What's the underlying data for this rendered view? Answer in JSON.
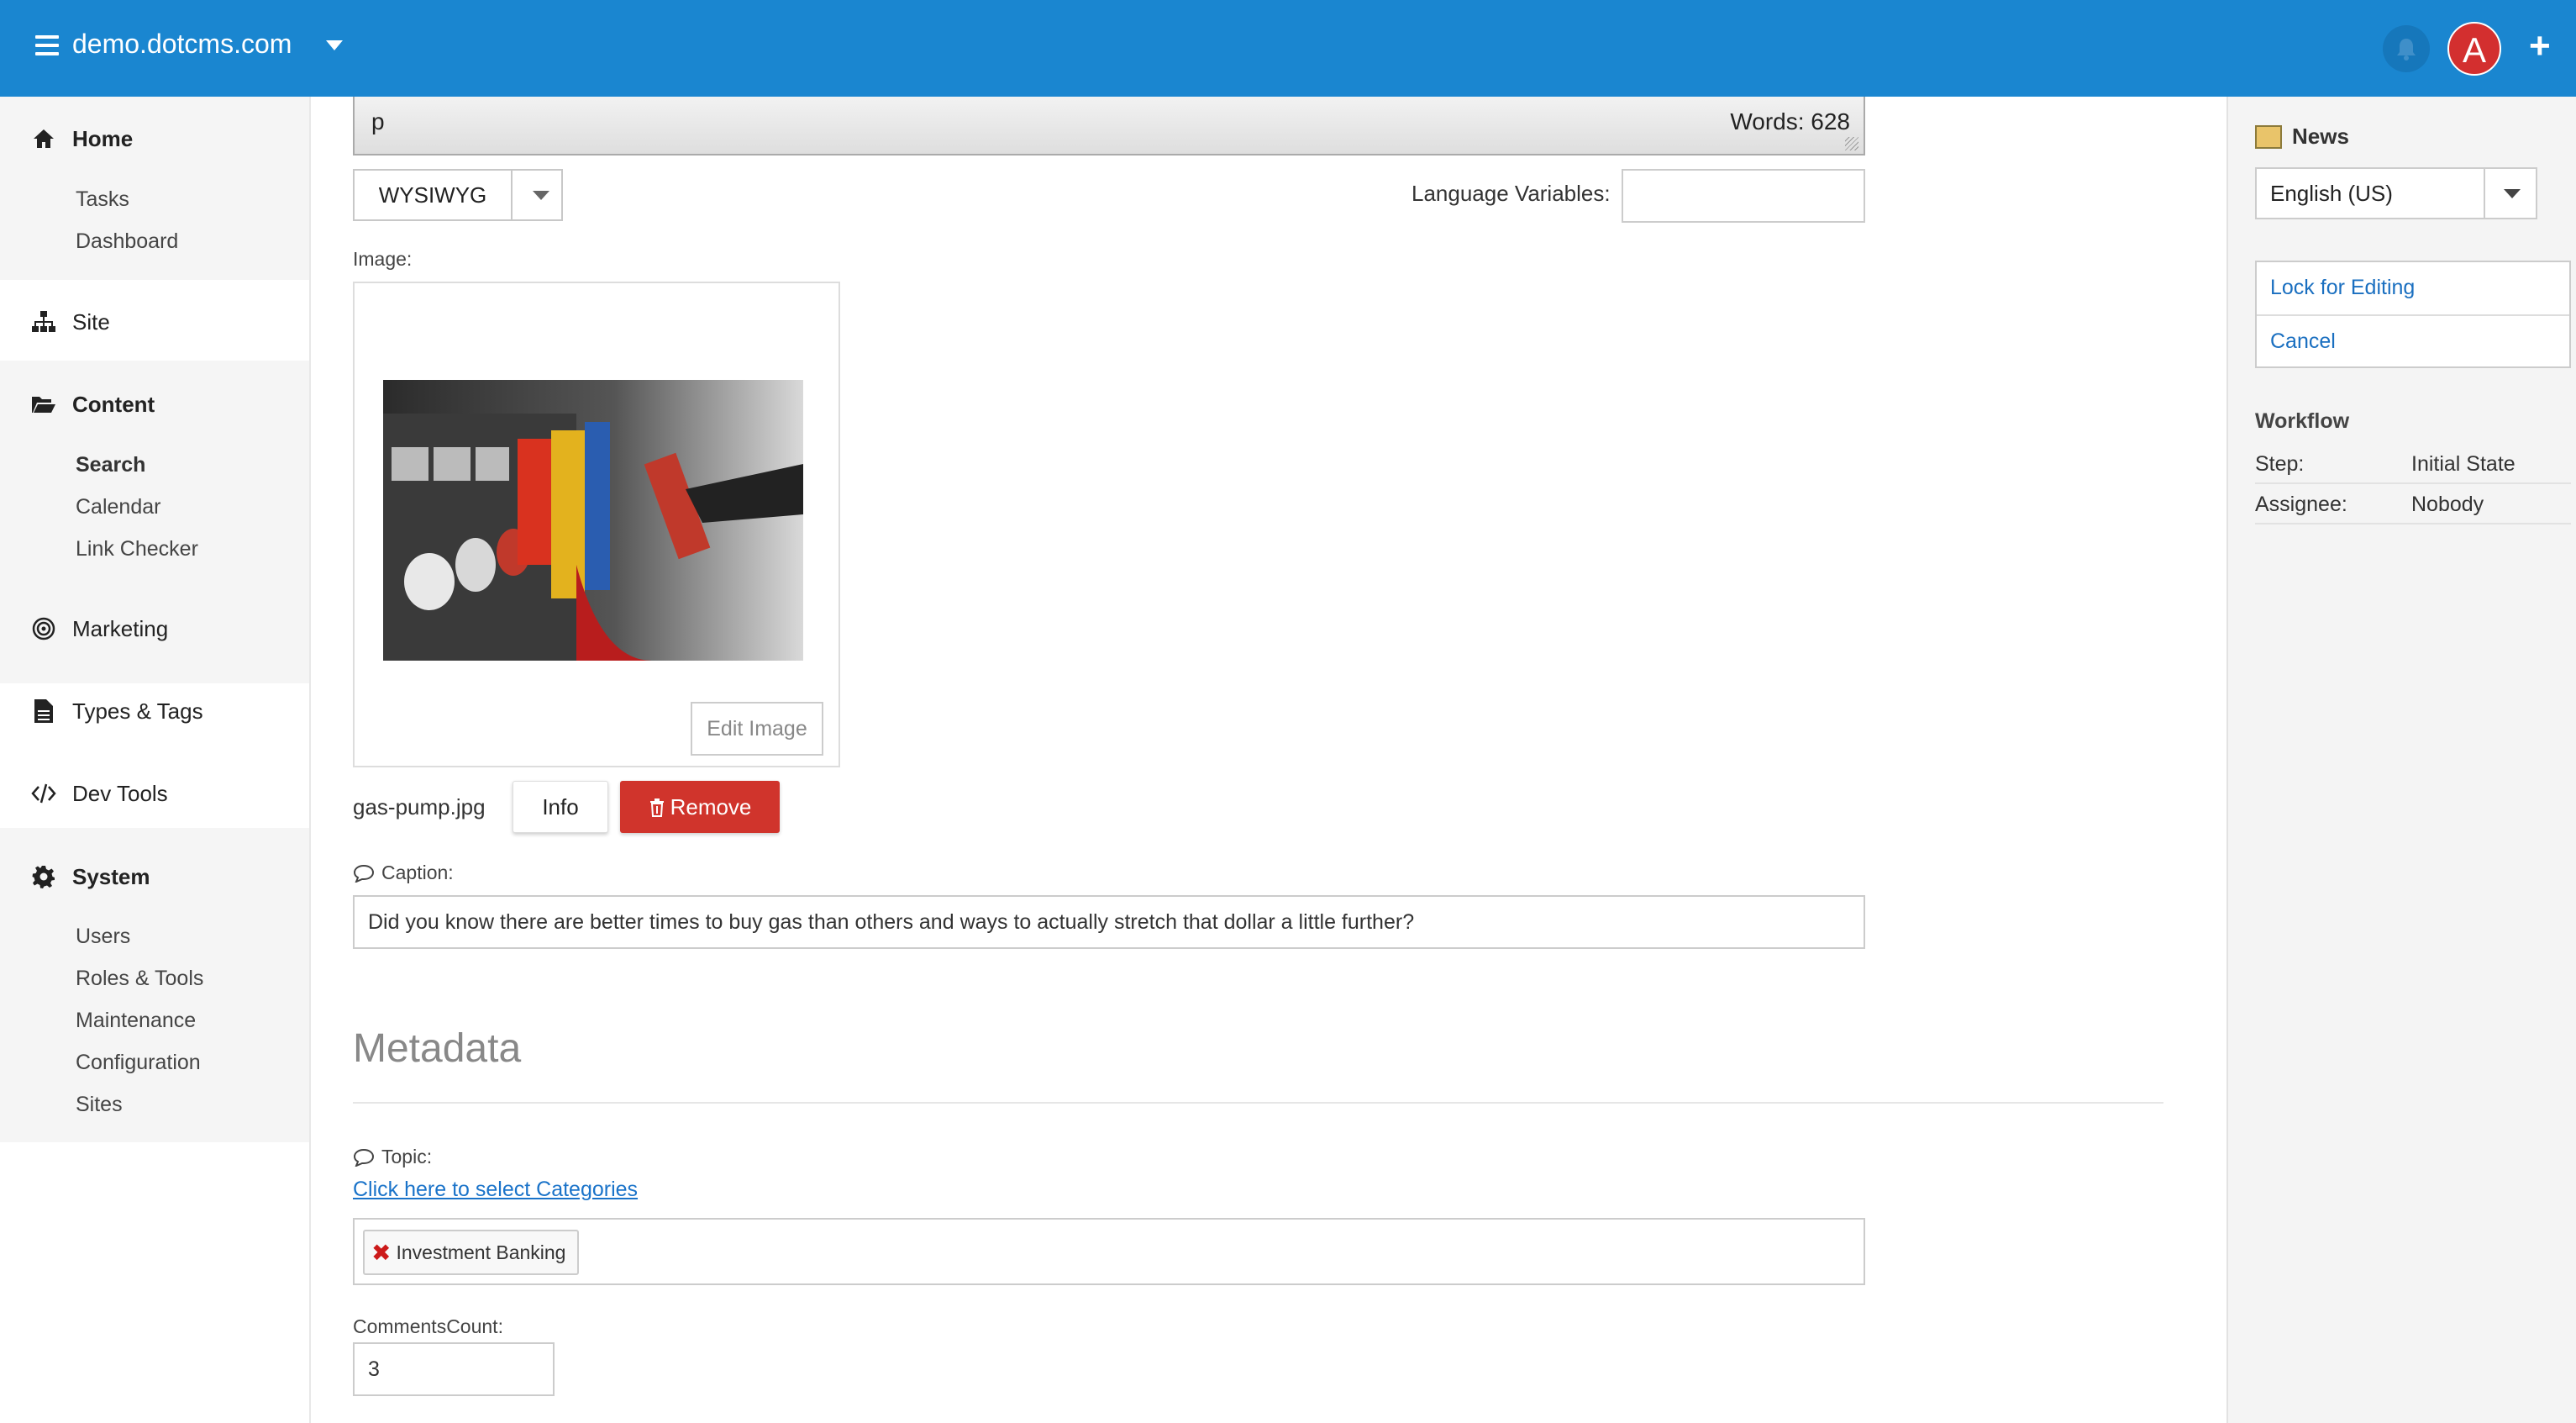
{
  "topbar": {
    "site_name": "demo.dotcms.com",
    "avatar_letter": "A",
    "brand_color": "#1a86d0"
  },
  "sidebar": {
    "home": {
      "label": "Home",
      "items": [
        "Tasks",
        "Dashboard"
      ]
    },
    "site": {
      "label": "Site"
    },
    "content": {
      "label": "Content",
      "items": [
        "Search",
        "Calendar",
        "Link Checker"
      ]
    },
    "marketing": {
      "label": "Marketing"
    },
    "types_tags": {
      "label": "Types & Tags"
    },
    "dev_tools": {
      "label": "Dev Tools"
    },
    "system": {
      "label": "System",
      "items": [
        "Users",
        "Roles & Tools",
        "Maintenance",
        "Configuration",
        "Sites"
      ]
    }
  },
  "editor": {
    "path_text": "p",
    "word_count": "Words: 628",
    "mode": "WYSIWYG",
    "language_variables_label": "Language Variables:",
    "language_variables_value": ""
  },
  "image_field": {
    "label": "Image:",
    "edit_label": "Edit Image",
    "filename": "gas-pump.jpg",
    "info_label": "Info",
    "remove_label": "Remove",
    "remove_color": "#d0342c"
  },
  "caption": {
    "label": "Caption:",
    "value": "Did you know there are better times to buy gas than others and ways to actually stretch that dollar a little further?"
  },
  "metadata": {
    "title": "Metadata",
    "topic_label": "Topic:",
    "categories_link": "Click here to select Categories",
    "tags": [
      "Investment Banking"
    ],
    "comments_label": "CommentsCount:",
    "comments_value": "3"
  },
  "right_panel": {
    "content_type": "News",
    "language": "English (US)",
    "actions": [
      "Lock for Editing",
      "Cancel"
    ],
    "workflow_title": "Workflow",
    "step_label": "Step:",
    "step_value": "Initial State",
    "assignee_label": "Assignee:",
    "assignee_value": "Nobody"
  }
}
